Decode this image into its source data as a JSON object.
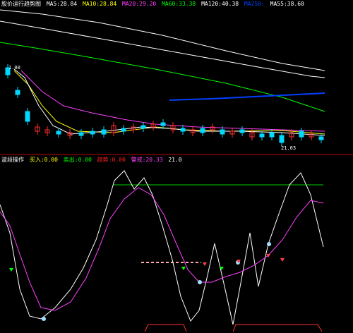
{
  "upper_panel": {
    "title": "股价运行趋势图",
    "indicators": [
      {
        "label": "MA5",
        "value": "28.84",
        "color": "#ffffff"
      },
      {
        "label": "MA10",
        "value": "28.84",
        "color": "#ffff00"
      },
      {
        "label": "MA20",
        "value": "29.20",
        "color": "#ff40ff"
      },
      {
        "label": "MA60",
        "value": "33.38",
        "color": "#00ff00"
      },
      {
        "label": "MA120",
        "value": "40.38",
        "color": "#ffffff"
      },
      {
        "label": "MA250",
        "value": "",
        "color": "#0040ff"
      },
      {
        "label": "MA55",
        "value": "38.60",
        "color": "#ffffff"
      }
    ],
    "high_price_label": "1.00",
    "low_price_label": "21.03",
    "colors": {
      "up": "#ff3030",
      "down": "#00d8ff",
      "divider": "#c00000"
    }
  },
  "lower_panel": {
    "title": "波段操作",
    "indicators": [
      {
        "label": "买入",
        "value": "0.00",
        "color": "#ffff00"
      },
      {
        "label": "卖出",
        "value": "0.00",
        "color": "#00ff00"
      },
      {
        "label": "趋势",
        "value": "0.00",
        "color": "#ff2020"
      },
      {
        "label": "警戒",
        "value": "20.33",
        "color": "#ff40ff"
      },
      {
        "label": "",
        "value": "21.0",
        "color": "#ffffff"
      }
    ],
    "reference_level_color": "#00cc00",
    "line_colors": {
      "fast": "#ffffff",
      "slow": "#ff40ff",
      "base": "#ff3030"
    }
  }
}
